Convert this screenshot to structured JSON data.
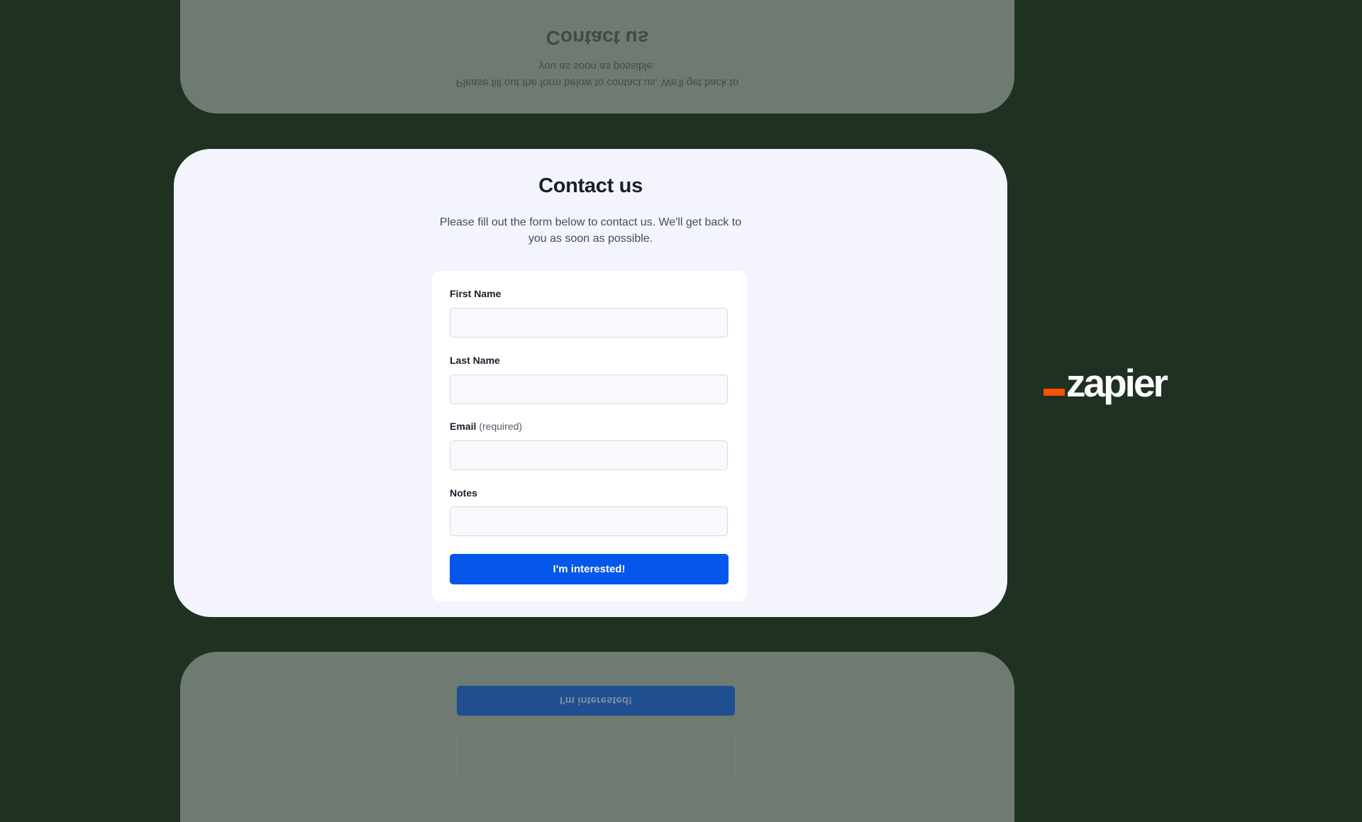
{
  "page": {
    "title": "Contact us",
    "subtitle_line1": "Please fill out the form below to contact us. We'll get back to",
    "subtitle_line2": "you as soon as possible."
  },
  "form": {
    "fields": [
      {
        "label": "First Name",
        "hint": "",
        "value": "",
        "placeholder": ""
      },
      {
        "label": "Last Name",
        "hint": "",
        "value": "",
        "placeholder": ""
      },
      {
        "label": "Email",
        "hint": "(required)",
        "value": "",
        "placeholder": ""
      },
      {
        "label": "Notes",
        "hint": "",
        "value": "",
        "placeholder": ""
      }
    ],
    "submit_label": "I'm interested!"
  },
  "brand": {
    "name": "zapier",
    "accent_color": "#ff4f00",
    "text_color": "#ffffff"
  },
  "reflections": {
    "top_title": "Contact us",
    "top_subtitle_line1": "Please fill out the form below to contact us. We'll get back to",
    "top_subtitle_line2": "you as soon as possible.",
    "bottom_button_label": "I'm interested!"
  },
  "colors": {
    "background": "#1f3121",
    "card": "#f4f5fc",
    "primary_button": "#0457ea",
    "ghost_card": "#6e7a72"
  }
}
